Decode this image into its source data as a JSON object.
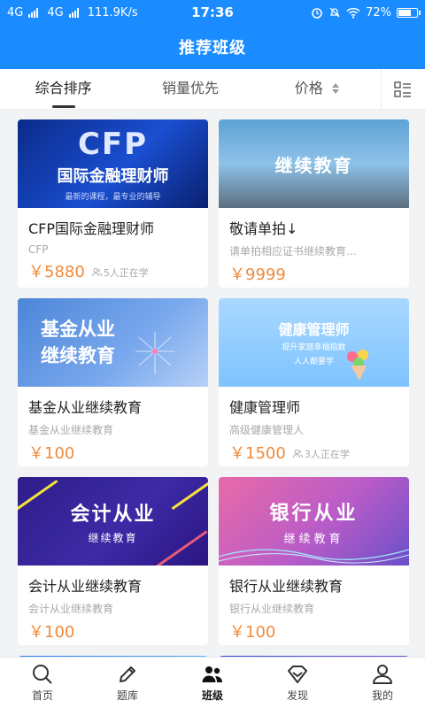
{
  "status_bar": {
    "network1": "4G",
    "network2": "4G",
    "speed": "111.9K/s",
    "time": "17:36",
    "battery": "72%",
    "battery_level": 0.72
  },
  "header": {
    "title": "推荐班级"
  },
  "sort_bar": {
    "tabs": [
      {
        "label": "综合排序",
        "active": true
      },
      {
        "label": "销量优先",
        "active": false
      },
      {
        "label": "价格",
        "active": false
      }
    ],
    "layout_icon": "list-layout-icon"
  },
  "courses": [
    {
      "title": "CFP国际金融理财师",
      "subtitle": "CFP",
      "price": "￥5880",
      "learners": "5人正在学",
      "banner": {
        "main": "CFP",
        "sub": "国际金融理财师",
        "tagline": "最新的课程，最专业的辅导"
      }
    },
    {
      "title": "敬请单拍↓",
      "subtitle": "请单拍相应证书继续教育…",
      "price": "￥9999",
      "learners": "",
      "banner": {
        "main": "继续教育"
      }
    },
    {
      "title": "基金从业继续教育",
      "subtitle": "基金从业继续教育",
      "price": "￥100",
      "learners": "",
      "banner": {
        "line1": "基金从业",
        "line2": "继续教育"
      }
    },
    {
      "title": "健康管理师",
      "subtitle": "高级健康管理人",
      "price": "￥1500",
      "learners": "3人正在学",
      "banner": {
        "main": "健康管理师",
        "line1": "提升家庭幸福指数",
        "line2": "人人都要学"
      }
    },
    {
      "title": "会计从业继续教育",
      "subtitle": "会计从业继续教育",
      "price": "￥100",
      "learners": "",
      "banner": {
        "main": "会计从业",
        "sub": "继续教育"
      }
    },
    {
      "title": "银行从业继续教育",
      "subtitle": "银行从业继续教育",
      "price": "￥100",
      "learners": "",
      "banner": {
        "main": "银行从业",
        "sub": "继续教育"
      }
    }
  ],
  "bottom_nav": [
    {
      "label": "首页",
      "icon": "search-icon",
      "active": false
    },
    {
      "label": "题库",
      "icon": "pencil-icon",
      "active": false
    },
    {
      "label": "班级",
      "icon": "class-icon",
      "active": true
    },
    {
      "label": "发现",
      "icon": "diamond-icon",
      "active": false
    },
    {
      "label": "我的",
      "icon": "person-icon",
      "active": false
    }
  ],
  "colors": {
    "primary": "#1a8cff",
    "price": "#f08a3a"
  }
}
